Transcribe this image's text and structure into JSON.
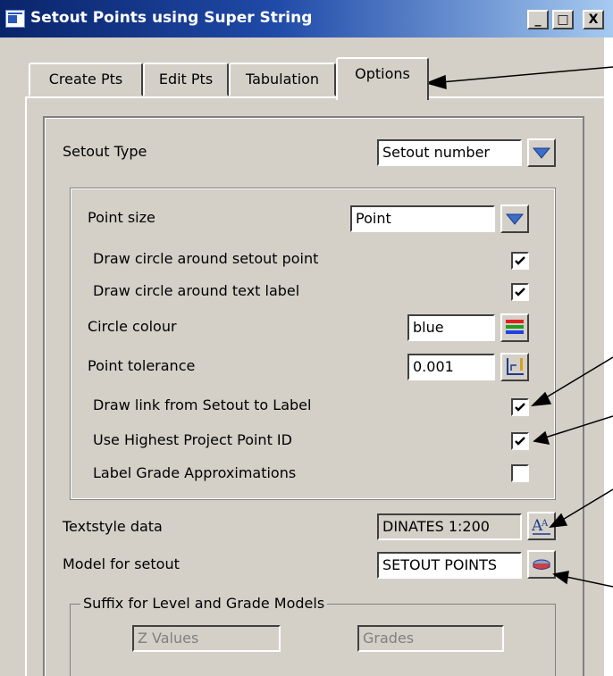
{
  "window": {
    "title": "Setout Points using Super String",
    "minimize": "_",
    "maximize": "□",
    "close": "X"
  },
  "tabs": [
    {
      "label": "Create Pts"
    },
    {
      "label": "Edit Pts"
    },
    {
      "label": "Tabulation"
    },
    {
      "label": "Options"
    }
  ],
  "options": {
    "setout_type_label": "Setout Type",
    "setout_type_value": "Setout number",
    "point_size_label": "Point size",
    "point_size_value": "Point",
    "draw_circle_setout_label": "Draw circle around setout point",
    "draw_circle_setout_checked": true,
    "draw_circle_text_label": "Draw circle around text label",
    "draw_circle_text_checked": true,
    "circle_colour_label": "Circle colour",
    "circle_colour_value": "blue",
    "point_tolerance_label": "Point tolerance",
    "point_tolerance_value": "0.001",
    "draw_link_label": "Draw link from Setout to Label",
    "draw_link_checked": true,
    "use_highest_label": "Use Highest Project Point ID",
    "use_highest_checked": true,
    "label_grade_label": "Label Grade Approximations",
    "label_grade_checked": false,
    "textstyle_label": "Textstyle data",
    "textstyle_value": "DINATES 1:200",
    "model_label": "Model for setout",
    "model_value": "SETOUT POINTS",
    "suffix_title": "Suffix for Level and Grade Models",
    "suffix_z_placeholder": "Z Values",
    "suffix_grades_placeholder": "Grades"
  },
  "icons": {
    "dropdown": "triangle-down-icon",
    "colour": "colour-bars-icon",
    "tolerance": "ruler-corner-icon",
    "textstyle": "textstyle-icon",
    "model": "model-picker-icon"
  },
  "colors": {
    "title_bar": "#0a246a",
    "dialog_bg": "#d4d0c8",
    "dropdown_arrow": "#3a6ec8"
  }
}
